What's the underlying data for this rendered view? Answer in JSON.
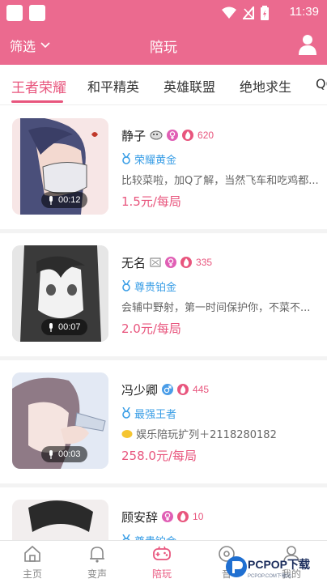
{
  "status_bar": {
    "time": "11:39"
  },
  "app_bar": {
    "filter_label": "筛选",
    "title": "陪玩"
  },
  "tabs": [
    {
      "label": "王者荣耀",
      "active": true
    },
    {
      "label": "和平精英",
      "active": false
    },
    {
      "label": "英雄联盟",
      "active": false
    },
    {
      "label": "绝地求生",
      "active": false
    },
    {
      "label": "QQ",
      "active": false
    }
  ],
  "companions": [
    {
      "name": "静子",
      "gender": "female",
      "hot": "620",
      "rank": "荣耀黄金",
      "desc": "比较菜啦，加Q了解，当然飞车和吃鸡都...",
      "price": "1.5元/每局",
      "voice": "00:12"
    },
    {
      "name": "无名",
      "gender": "female",
      "hot": "335",
      "rank": "尊贵铂金",
      "desc": "会辅中野射，第一时间保护你，不菜不...",
      "price": "2.0元/每局",
      "voice": "00:07"
    },
    {
      "name": "冯少卿",
      "gender": "male",
      "hot": "445",
      "rank": "最强王者",
      "desc": "娱乐陪玩扩列＋2118280182",
      "price": "258.0元/每局",
      "voice": "00:03"
    },
    {
      "name": "顾安辞",
      "gender": "female",
      "hot": "10",
      "rank": "尊贵铂金",
      "desc": "",
      "price": "",
      "voice": ""
    }
  ],
  "bottom_nav": [
    {
      "label": "主页",
      "icon": "home-icon",
      "active": false
    },
    {
      "label": "变声",
      "icon": "bell-icon",
      "active": false
    },
    {
      "label": "陪玩",
      "icon": "gamepad-icon",
      "active": true
    },
    {
      "label": "音",
      "icon": "music-icon",
      "active": false
    },
    {
      "label": "我的",
      "icon": "profile-icon",
      "active": false
    }
  ],
  "watermark": {
    "text": "PCPOP下载",
    "subtext": "PCPOP.COM下载站"
  },
  "colors": {
    "brand": "#eb6a8f",
    "accent": "#e8557d",
    "rank": "#3a9ee6",
    "female": "#e05fb5",
    "male": "#4a9de8"
  }
}
